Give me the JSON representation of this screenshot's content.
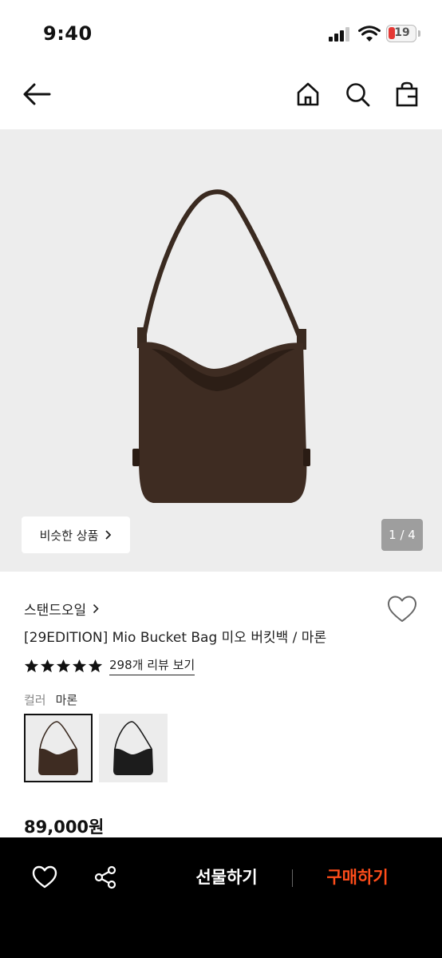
{
  "status_bar": {
    "time": "9:40",
    "battery": "19"
  },
  "header": {
    "back_icon": "arrow-left-icon",
    "home_icon": "home-icon",
    "search_icon": "search-icon",
    "bag_icon": "shopping-bag-icon"
  },
  "hero": {
    "similar_label": "비슷한 상품",
    "page_indicator": "1 / 4",
    "image": "brown suede bucket bag"
  },
  "product": {
    "brand": "스탠드오일",
    "name": "[29EDITION] Mio Bucket Bag 미오 버킷백 / 마론",
    "rating_stars": 5,
    "review_link": "298개 리뷰 보기",
    "color_label": "컬러",
    "color_value": "마론",
    "swatches": [
      "brown",
      "black"
    ],
    "price": "89,000원"
  },
  "bottom_bar": {
    "gift_label": "선물하기",
    "buy_label": "구매하기"
  },
  "colors": {
    "accent": "#ff4d1a",
    "bag_brown": "#3e2c22",
    "hero_bg": "#ededed"
  }
}
